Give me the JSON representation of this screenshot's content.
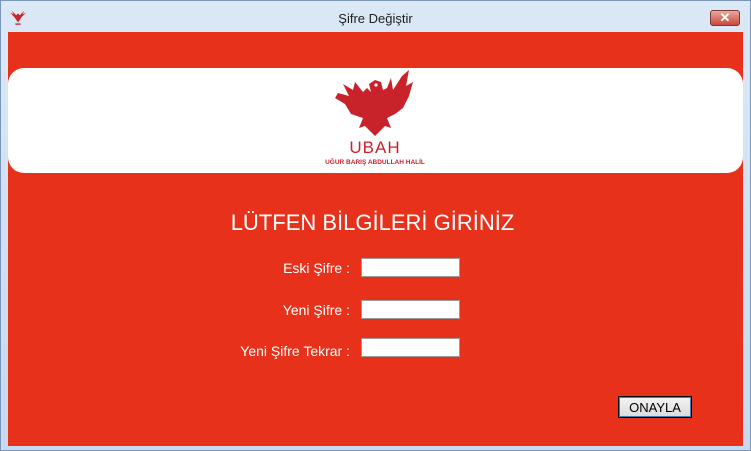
{
  "window": {
    "title": "Şifre Değiştir",
    "close_glyph": "✕"
  },
  "logo": {
    "name": "UBAH",
    "subtitle": "UĞUR BARIŞ ABDULLAH HALİL",
    "color": "#c8232b"
  },
  "form": {
    "heading": "LÜTFEN BİLGİLERİ GİRİNİZ",
    "fields": [
      {
        "label": "Eski Şifre :",
        "value": ""
      },
      {
        "label": "Yeni Şifre :",
        "value": ""
      },
      {
        "label": "Yeni Şifre Tekrar :",
        "value": ""
      }
    ],
    "submit_label": "ONAYLA"
  },
  "colors": {
    "background": "#e8311a",
    "text": "#ffffff",
    "banner": "#ffffff"
  }
}
